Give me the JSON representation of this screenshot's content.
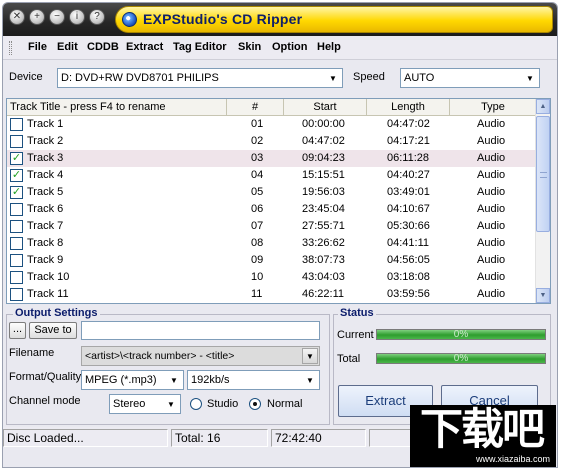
{
  "window": {
    "title": "EXPStudio's CD Ripper"
  },
  "menu": [
    "File",
    "Edit",
    "CDDB",
    "Extract",
    "Tag Editor",
    "Skin",
    "Option",
    "Help"
  ],
  "device": {
    "label": "Device",
    "value": "D: DVD+RW DVD8701  PHILIPS",
    "speed_label": "Speed",
    "speed_value": "AUTO"
  },
  "tracks": {
    "columns": [
      "Track Title - press F4 to rename",
      "#",
      "Start",
      "Length",
      "Type"
    ],
    "rows": [
      {
        "title": "Track 1",
        "num": "01",
        "start": "00:00:00",
        "length": "04:47:02",
        "type": "Audio",
        "checked": false,
        "selected": false
      },
      {
        "title": "Track 2",
        "num": "02",
        "start": "04:47:02",
        "length": "04:17:21",
        "type": "Audio",
        "checked": false,
        "selected": false
      },
      {
        "title": "Track 3",
        "num": "03",
        "start": "09:04:23",
        "length": "06:11:28",
        "type": "Audio",
        "checked": true,
        "selected": true
      },
      {
        "title": "Track 4",
        "num": "04",
        "start": "15:15:51",
        "length": "04:40:27",
        "type": "Audio",
        "checked": true,
        "selected": false
      },
      {
        "title": "Track 5",
        "num": "05",
        "start": "19:56:03",
        "length": "03:49:01",
        "type": "Audio",
        "checked": true,
        "selected": false
      },
      {
        "title": "Track 6",
        "num": "06",
        "start": "23:45:04",
        "length": "04:10:67",
        "type": "Audio",
        "checked": false,
        "selected": false
      },
      {
        "title": "Track 7",
        "num": "07",
        "start": "27:55:71",
        "length": "05:30:66",
        "type": "Audio",
        "checked": false,
        "selected": false
      },
      {
        "title": "Track 8",
        "num": "08",
        "start": "33:26:62",
        "length": "04:41:11",
        "type": "Audio",
        "checked": false,
        "selected": false
      },
      {
        "title": "Track 9",
        "num": "09",
        "start": "38:07:73",
        "length": "04:56:05",
        "type": "Audio",
        "checked": false,
        "selected": false
      },
      {
        "title": "Track 10",
        "num": "10",
        "start": "43:04:03",
        "length": "03:18:08",
        "type": "Audio",
        "checked": false,
        "selected": false
      },
      {
        "title": "Track 11",
        "num": "11",
        "start": "46:22:11",
        "length": "03:59:56",
        "type": "Audio",
        "checked": false,
        "selected": false
      }
    ]
  },
  "output": {
    "title": "Output Settings",
    "browse_label": "...",
    "save_to_label": "Save to",
    "save_to_value": "",
    "filename_label": "Filename",
    "filename_value": "<artist>\\<track number> - <title>",
    "format_label": "Format/Quality",
    "format_value": "MPEG (*.mp3)",
    "quality_value": "192kb/s",
    "channel_label": "Channel mode",
    "channel_value": "Stereo",
    "radio_studio": "Studio",
    "radio_normal": "Normal",
    "radio_selected": "Normal"
  },
  "status": {
    "title": "Status",
    "current_label": "Current",
    "current_text": "0%",
    "current_progress": 1.0,
    "total_label": "Total",
    "total_text": "0%",
    "total_progress": 1.0
  },
  "actions": {
    "extract": "Extract",
    "cancel": "Cancel"
  },
  "statusbar": {
    "state": "Disc Loaded...",
    "total": "Total: 16",
    "duration": "72:42:40"
  },
  "watermark": {
    "text": "下载吧",
    "url": "www.xiazaiba.com"
  },
  "colors": {
    "title_pill": "#ffd800",
    "title_text": "#10206a",
    "progress_fill": "#2e9d2e",
    "group_title": "#0b1c6b"
  }
}
